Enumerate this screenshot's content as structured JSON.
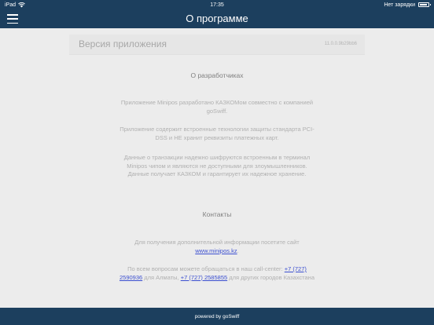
{
  "statusbar": {
    "device": "iPad",
    "time": "17:35",
    "charging": "Нет зарядки"
  },
  "navbar": {
    "title": "О программе"
  },
  "version": {
    "label": "Версия приложения",
    "value": "11.0.0.9b29bb6"
  },
  "about": {
    "title": "О разработчиках",
    "p1": "Приложение Minipos разработано КАЗКОМом совместно с компанией goSwiff.",
    "p2": "Приложение содержит встроенные технологии защиты стандарта PCI-DSS и НЕ хранит реквизиты платежных карт.",
    "p3": "Данные о транзакции надежно шифруются встроенным в терминал Minipos чипом и являются не доступными для злоумышленников. Данные получает КАЗКОМ и гарантирует их надежное хранение."
  },
  "contacts": {
    "title": "Контакты",
    "info_text": "Для получения дополнительной информации посетите сайт",
    "site_link": "www.minipos.kz",
    "site_suffix": ".",
    "call_text": "По всем вопросам можете обращаться в наш call-center:",
    "phone1": "+7 (727) 2590936",
    "phone1_suffix": "для Алматы,",
    "phone2": "+7 (727) 2585855",
    "phone2_suffix": "для других городов Казахстана"
  },
  "footer": {
    "text": "powered by goSwiff"
  }
}
